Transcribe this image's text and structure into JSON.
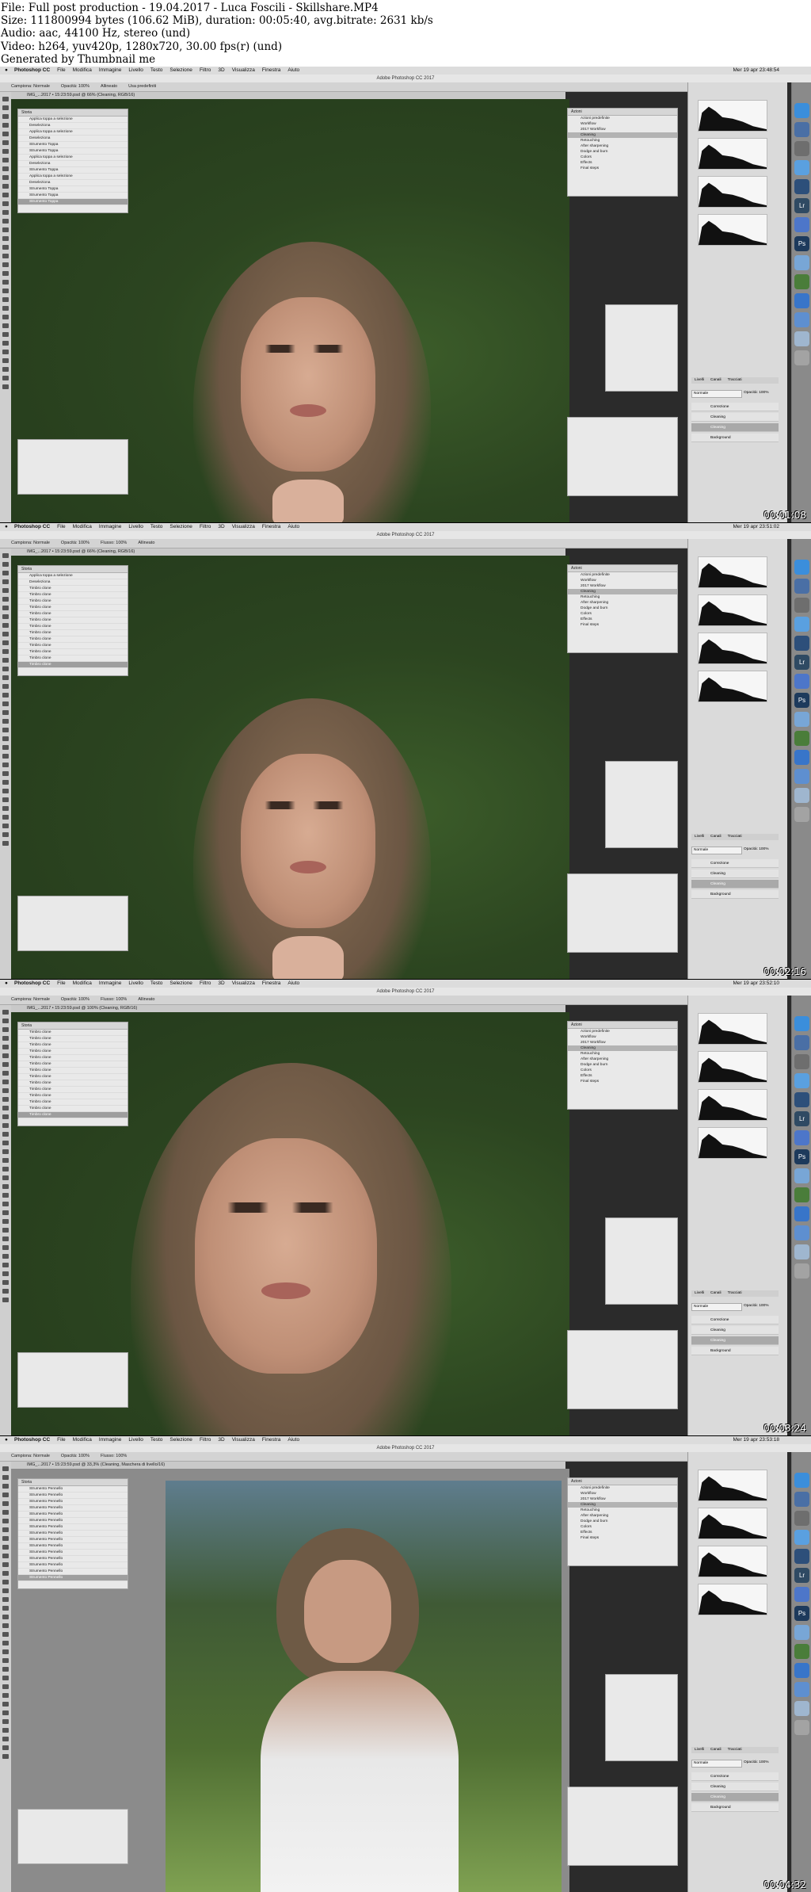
{
  "header": {
    "lines": [
      "File: Full post production - 19.04.2017 - Luca Foscili - Skillshare.MP4",
      "Size: 111800994 bytes (106.62 MiB), duration: 00:05:40, avg.bitrate: 2631 kb/s",
      "Audio: aac, 44100 Hz, stereo (und)",
      "Video: h264, yuv420p, 1280x720, 30.00 fps(r) (und)",
      "Generated by Thumbnail me"
    ]
  },
  "menubar": {
    "apple": "",
    "items": [
      "Photoshop CC",
      "File",
      "Modifica",
      "Immagine",
      "Livello",
      "Testo",
      "Selezione",
      "Filtro",
      "3D",
      "Visualizza",
      "Finestra",
      "Aiuto"
    ]
  },
  "window_title": "Adobe Photoshop CC 2017",
  "frames": [
    {
      "timestamp": "00:01:08",
      "clock": "Mer 19 apr 23:48:54",
      "doc_tab": "IMG_...2017 • 15:23:59.psd @ 66% (Cleaning, RGB/16)",
      "options": [
        "Campiona: Normale",
        "Opacità: 100%",
        "Allineato",
        "Usa predefiniti"
      ],
      "history_title": "Storia",
      "history": [
        "Applica toppa a selezione",
        "Deseleziona",
        "Applica toppa a selezione",
        "Deseleziona",
        "Strumento Toppa",
        "Strumento Toppa",
        "Applica toppa a selezione",
        "Deseleziona",
        "Strumento Toppa",
        "Applica toppa a selezione",
        "Deseleziona",
        "Strumento Toppa",
        "Strumento Toppa",
        "Strumento Toppa"
      ],
      "selected": 13,
      "photo": "closeup1"
    },
    {
      "timestamp": "00:02:16",
      "clock": "Mer 19 apr 23:51:02",
      "doc_tab": "IMG_...2017 • 15:23:59.psd @ 66% (Cleaning, RGB/16)",
      "options": [
        "Campiona: Normale",
        "Opacità: 100%",
        "Flusso: 100%",
        "Allineato"
      ],
      "history_title": "Storia",
      "history": [
        "Applica toppa a selezione",
        "Deseleziona",
        "Timbro clone",
        "Timbro clone",
        "Timbro clone",
        "Timbro clone",
        "Timbro clone",
        "Timbro clone",
        "Timbro clone",
        "Timbro clone",
        "Timbro clone",
        "Timbro clone",
        "Timbro clone",
        "Timbro clone",
        "Timbro clone"
      ],
      "selected": 14,
      "photo": "closeup2"
    },
    {
      "timestamp": "00:03:24",
      "clock": "Mer 19 apr 23:52:10",
      "doc_tab": "IMG_...2017 • 15:23:59.psd @ 100% (Cleaning, RGB/16)",
      "options": [
        "Campiona: Normale",
        "Opacità: 100%",
        "Flusso: 100%",
        "Allineato"
      ],
      "history_title": "Storia",
      "history": [
        "Timbro clone",
        "Timbro clone",
        "Timbro clone",
        "Timbro clone",
        "Timbro clone",
        "Timbro clone",
        "Timbro clone",
        "Timbro clone",
        "Timbro clone",
        "Timbro clone",
        "Timbro clone",
        "Timbro clone",
        "Timbro clone",
        "Timbro clone"
      ],
      "selected": 13,
      "photo": "closeup3"
    },
    {
      "timestamp": "00:04:32",
      "clock": "Mer 19 apr 23:53:18",
      "doc_tab": "IMG_...2017 • 15:23:59.psd @ 33,3% (Cleaning, Maschera di livello/16)",
      "options": [
        "Campiona: Normale",
        "Opacità: 100%",
        "Flusso: 100%"
      ],
      "history_title": "Storia",
      "history": [
        "Strumento Pennello",
        "Strumento Pennello",
        "Strumento Pennello",
        "Strumento Pennello",
        "Strumento Pennello",
        "Strumento Pennello",
        "Strumento Pennello",
        "Strumento Pennello",
        "Strumento Pennello",
        "Strumento Pennello",
        "Strumento Pennello",
        "Strumento Pennello",
        "Strumento Pennello",
        "Strumento Pennello",
        "Strumento Pennello"
      ],
      "selected": 14,
      "photo": "full"
    }
  ],
  "actions_panel": {
    "title": "Azioni",
    "items": [
      "Azioni predefinite",
      "Workflow",
      "2017 Workflow",
      "Cleaning",
      "Retouching",
      "After sharpening",
      "Dodge and burn",
      "Colors",
      "Effects",
      "Final steps"
    ],
    "selected": 3
  },
  "layers_panel": {
    "tabs": [
      "Livelli",
      "Canali",
      "Tracciati"
    ],
    "blend_mode": "Normale",
    "opacity": "Opacità: 100%",
    "rows": [
      "Correzione",
      "Cleaning",
      "Cleaning",
      "Background"
    ],
    "selected": 2
  },
  "dock": [
    {
      "label": "",
      "color": "#3b8edb"
    },
    {
      "label": "",
      "color": "#4a6fa5"
    },
    {
      "label": "",
      "color": "#6e6e6e"
    },
    {
      "label": "",
      "color": "#5aa0e0"
    },
    {
      "label": "",
      "color": "#2d4f7a"
    },
    {
      "label": "Lr",
      "color": "#2f4a63"
    },
    {
      "label": "",
      "color": "#4d76c9"
    },
    {
      "label": "Ps",
      "color": "#1d3a5c"
    },
    {
      "label": "",
      "color": "#78a6d6"
    },
    {
      "label": "",
      "color": "#4a7d3a"
    },
    {
      "label": "",
      "color": "#3875c9"
    },
    {
      "label": "",
      "color": "#5e8fd0"
    },
    {
      "label": "",
      "color": "#9fb6cf"
    },
    {
      "label": "",
      "color": "#a3a3a3"
    }
  ]
}
